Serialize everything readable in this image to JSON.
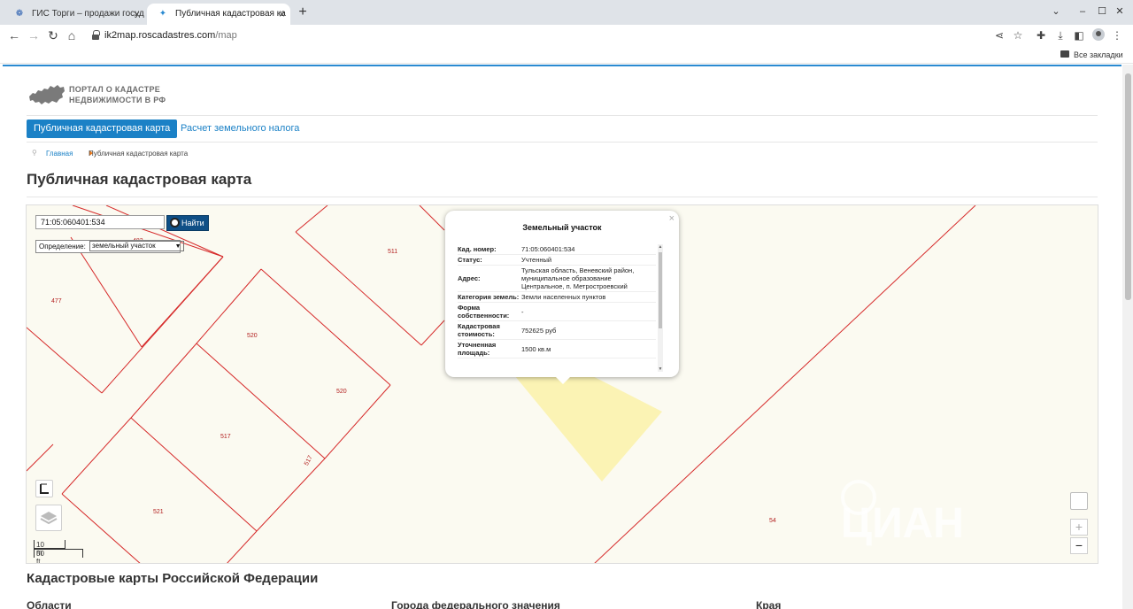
{
  "browser": {
    "tabs": [
      {
        "title": "ГИС Торги – продажи госуд",
        "active": false
      },
      {
        "title": "Публичная кадастровая ка",
        "active": true
      }
    ],
    "url_host": "ik2map.roscadastres.com",
    "url_path": "/map",
    "bookmarks_label": "Все закладки"
  },
  "site": {
    "logo_line1": "ПОРТАЛ О КАДАСТРЕ",
    "logo_line2": "НЕДВИЖИМОСТИ В РФ",
    "nav": {
      "active": "Публичная кадастровая карта",
      "link": "Расчет земельного налога"
    },
    "breadcrumb": {
      "home": "Главная",
      "current": "Публичная кадастровая карта"
    },
    "page_title": "Публичная кадастровая карта"
  },
  "map": {
    "search_value": "71:05:060401:534",
    "search_button": "Найти",
    "definition_label": "Определение:",
    "definition_value": "земельный участок",
    "plot_numbers": {
      "n1": "511",
      "n2": "477",
      "n3": "520",
      "n4": "520",
      "n5": "517",
      "n6": "517",
      "n7": "521",
      "n8": "54",
      "n9": "482"
    },
    "scale": {
      "metric": "10 m",
      "imperial": "50 ft"
    },
    "zoom_in": "+",
    "zoom_out": "−",
    "popup": {
      "title": "Земельный участок",
      "close": "×",
      "rows": [
        {
          "key": "Кад. номер:",
          "value": "71:05:060401:534"
        },
        {
          "key": "Статус:",
          "value": "Учтенный"
        },
        {
          "key": "Адрес:",
          "value": "Тульская область, Веневский район, муниципальное образование Центральное, п. Метростроевский"
        },
        {
          "key": "Категория земель:",
          "value": "Земли населенных пунктов"
        },
        {
          "key": "Форма собственности:",
          "value": "-"
        },
        {
          "key": "Кадастровая стоимость:",
          "value": "752625 руб"
        },
        {
          "key": "Уточненная площадь:",
          "value": "1500 кв.м"
        }
      ]
    },
    "colors": {
      "boundary": "#d62a2a",
      "selected_plot": "#fbf3b4",
      "background": "#fbfaf1"
    }
  },
  "bottom": {
    "section_title": "Кадастровые карты Российской Федерации",
    "col1": "Области",
    "col2": "Города федерального значения",
    "col3": "Края"
  }
}
